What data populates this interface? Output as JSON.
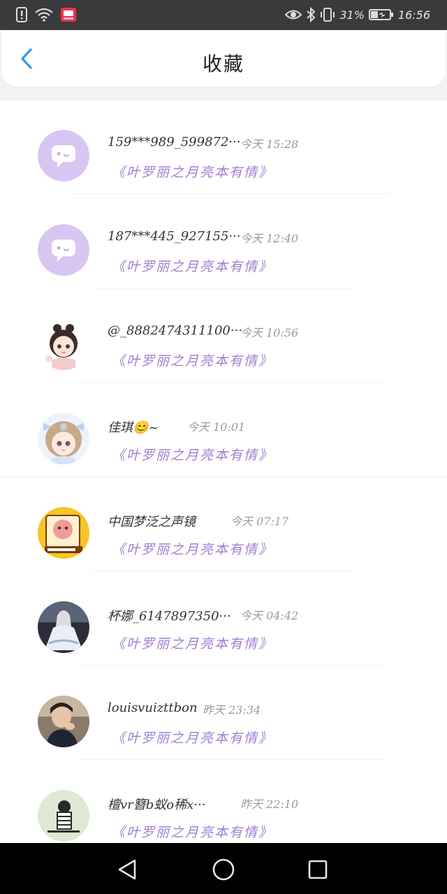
{
  "status_bar": {
    "battery": "31%",
    "time": "16:56",
    "icons": [
      "alert-icon",
      "wifi-icon",
      "app-badge-icon",
      "eye-icon",
      "bluetooth-icon",
      "vibrate-icon",
      "battery-icon"
    ]
  },
  "header": {
    "title": "收藏",
    "back_icon": "chevron-left-icon"
  },
  "items": [
    {
      "name": "159***989_599872···",
      "time": "今天  15:28",
      "book": "《叶罗丽之月亮本有情》",
      "avatar": "chat-bubble-icon"
    },
    {
      "name": "187***445_927155···",
      "time": "今天  12:40",
      "book": "《叶罗丽之月亮本有情》",
      "avatar": "chat-bubble-icon"
    },
    {
      "name": "@_8882474311100···",
      "time": "今天  10:56",
      "book": "《叶罗丽之月亮本有情》",
      "avatar": "anime-girl"
    },
    {
      "name": "佳琪😊~",
      "time": "今天  10:01",
      "book": "《叶罗丽之月亮本有情》",
      "avatar": "anime-girl-bow"
    },
    {
      "name": "中国梦泛之声镜",
      "time": "今天  07:17",
      "book": "《叶罗丽之月亮本有情》",
      "avatar": "cartoon-sticker"
    },
    {
      "name": "杯娜_6147897350···",
      "time": "今天  04:42",
      "book": "《叶罗丽之月亮本有情》",
      "avatar": "lolita-photo"
    },
    {
      "name": "louisvuizttbon",
      "time": "昨天  23:34",
      "book": "《叶罗丽之月亮本有情》",
      "avatar": "boy-photo"
    },
    {
      "name": "檀vr簪b蚁o稀x···",
      "time": "昨天  22:10",
      "book": "《叶罗丽之月亮本有情》",
      "avatar": "sketch-drawing"
    }
  ],
  "nav": {
    "back": "triangle-back-icon",
    "home": "circle-home-icon",
    "recent": "square-recent-icon"
  }
}
